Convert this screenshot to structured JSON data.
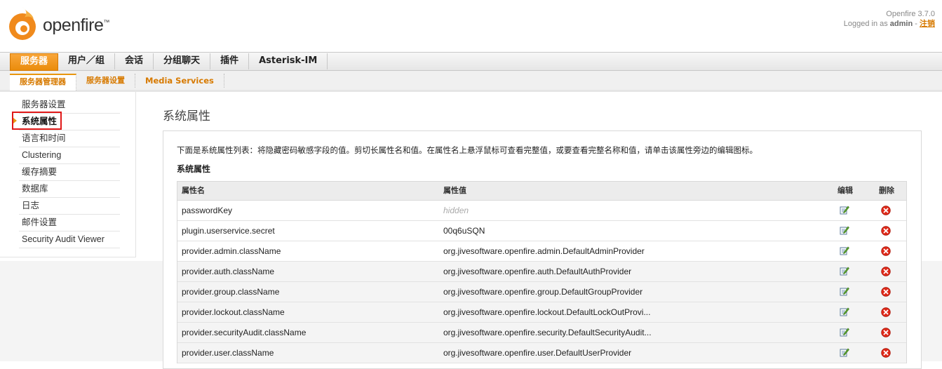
{
  "header": {
    "logo_text": "openfire",
    "logo_tm": "™",
    "version": "Openfire 3.7.0",
    "logged_in_prefix": "Logged in as",
    "user": "admin",
    "separator": "-",
    "logout": "注销",
    "brand_color": "#e8960f"
  },
  "main_tabs": [
    {
      "label": "服务器",
      "active": true
    },
    {
      "label": "用户／组",
      "active": false
    },
    {
      "label": "会话",
      "active": false
    },
    {
      "label": "分组聊天",
      "active": false
    },
    {
      "label": "插件",
      "active": false
    },
    {
      "label": "Asterisk-IM",
      "active": false
    }
  ],
  "sub_tabs": [
    {
      "label": "服务器管理器",
      "active": true
    },
    {
      "label": "服务器设置",
      "active": false
    },
    {
      "label": "Media Services",
      "active": false
    }
  ],
  "sidebar": {
    "items": [
      {
        "label": "服务器设置"
      },
      {
        "label": "系统属性",
        "active": true
      },
      {
        "label": "语言和时间"
      },
      {
        "label": "Clustering"
      },
      {
        "label": "缓存摘要"
      },
      {
        "label": "数据库"
      },
      {
        "label": "日志"
      },
      {
        "label": "邮件设置"
      },
      {
        "label": "Security Audit Viewer"
      }
    ]
  },
  "content": {
    "title": "系统属性",
    "description": "下面是系统属性列表：将隐藏密码敏感字段的值。剪切长属性名和值。在属性名上悬浮鼠标可查看完整值，或要查看完整名称和值，请单击该属性旁边的编辑图标。",
    "section_title": "系统属性",
    "table": {
      "headers": {
        "name": "属性名",
        "value": "属性值",
        "edit": "编辑",
        "delete": "删除"
      },
      "rows": [
        {
          "name": "passwordKey",
          "value": "hidden",
          "hidden": true
        },
        {
          "name": "plugin.userservice.secret",
          "value": "00q6uSQN"
        },
        {
          "name": "provider.admin.className",
          "value": "org.jivesoftware.openfire.admin.DefaultAdminProvider"
        },
        {
          "name": "provider.auth.className",
          "value": "org.jivesoftware.openfire.auth.DefaultAuthProvider"
        },
        {
          "name": "provider.group.className",
          "value": "org.jivesoftware.openfire.group.DefaultGroupProvider"
        },
        {
          "name": "provider.lockout.className",
          "value": "org.jivesoftware.openfire.lockout.DefaultLockOutProvi..."
        },
        {
          "name": "provider.securityAudit.className",
          "value": "org.jivesoftware.openfire.security.DefaultSecurityAudit..."
        },
        {
          "name": "provider.user.className",
          "value": "org.jivesoftware.openfire.user.DefaultUserProvider"
        }
      ]
    }
  }
}
